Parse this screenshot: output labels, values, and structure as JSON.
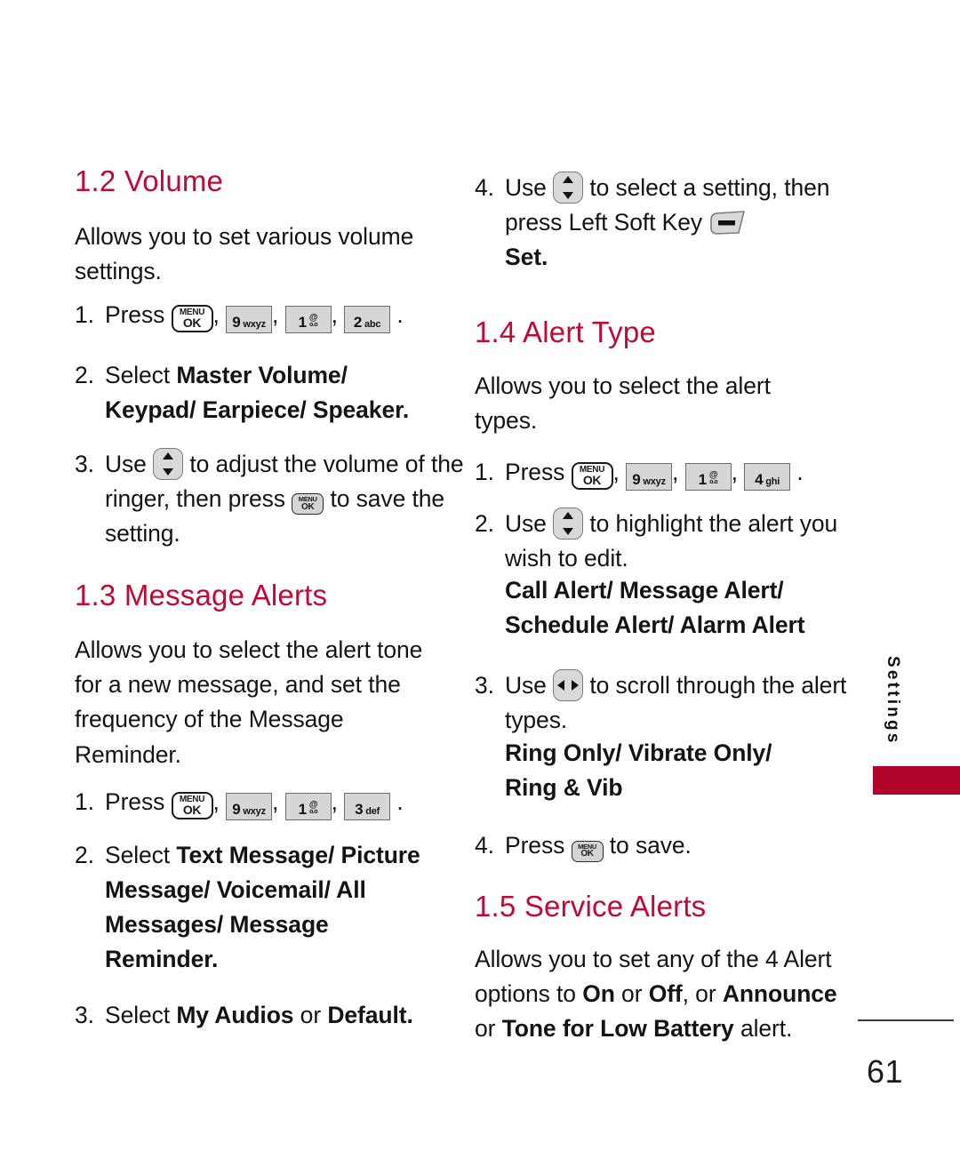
{
  "page": {
    "number": "61",
    "side_tab_label": "Settings",
    "accent_heading_color": "#BE0A34",
    "side_tab_bar_color": "#B2032B"
  },
  "keys": {
    "menu_ok_line1": "MENU",
    "menu_ok_line2": "OK",
    "key9_digit": "9",
    "key9_sub": "wxyz",
    "key1_digit": "1",
    "key1_sub_top": "@",
    "key1_sub_bottom": "o.o",
    "key2_digit": "2",
    "key2_sub": "abc",
    "key3_digit": "3",
    "key3_sub": "def",
    "key4_digit": "4",
    "key4_sub": "ghi",
    "nav_updown_name": "up-down-navigation-key",
    "nav_leftright_name": "left-right-navigation-key",
    "left_soft_key_name": "left-soft-key"
  },
  "left_column": {
    "section_1_2": {
      "heading": "1.2 Volume",
      "intro": "Allows you to set various volume settings.",
      "step1_num": "1.",
      "step1_label": "Press",
      "step1_tail": ".",
      "step2_num": "2.",
      "step2_lead": "Select ",
      "step2_bold_line1": "Master Volume/",
      "step2_bold_line2": "Keypad/ Earpiece/ Speaker",
      "step2_tail": ".",
      "step3_num": "3.",
      "step3_lead": "Use ",
      "step3_mid": " to adjust the volume of the ringer, then press ",
      "step3_tail": " to save the setting."
    },
    "section_1_3": {
      "heading": "1.3 Message Alerts",
      "intro": "Allows you to select the alert tone for a new message, and set the frequency of the Message Reminder.",
      "step1_num": "1.",
      "step1_label": "Press",
      "step1_tail": ".",
      "step2_num": "2.",
      "step2_lead": "Select ",
      "step2_bold_line1": "Text Message/ Picture",
      "step2_bold_line2": "Message/ Voicemail/ All",
      "step2_bold_line3": "Messages/ Message",
      "step2_bold_line4": "Reminder",
      "step2_tail": ".",
      "step3_num": "3.",
      "step3_lead": "Select ",
      "step3_bold_1": "My Audios",
      "step3_mid": " or ",
      "step3_bold_2": "Default",
      "step3_tail": "."
    }
  },
  "right_column": {
    "section_1_2_cont": {
      "step4_num": "4.",
      "step4_lead": "Use ",
      "step4_mid": " to select a setting, then press Left Soft Key ",
      "step4_bold": "Set",
      "step4_tail": "."
    },
    "section_1_4": {
      "heading": "1.4 Alert Type",
      "intro": "Allows you to select the alert types.",
      "step1_num": "1.",
      "step1_label": "Press",
      "step1_tail": ".",
      "step2_num": "2.",
      "step2_lead": "Use ",
      "step2_mid": " to highlight the alert you wish to edit.",
      "step2_bold_line1": "Call Alert/ Message Alert/",
      "step2_bold_line2": "Schedule Alert/ Alarm Alert",
      "step3_num": "3.",
      "step3_lead": "Use ",
      "step3_mid": " to scroll through the alert types.",
      "step3_bold_line1": "Ring Only/ Vibrate Only/",
      "step3_bold_line2": "Ring & Vib",
      "step4_num": "4.",
      "step4_lead": "Press ",
      "step4_tail": " to save."
    },
    "section_1_5": {
      "heading": "1.5 Service Alerts",
      "intro_1": "Allows you to set any of the 4 Alert options to ",
      "intro_bold_1": "On",
      "intro_2": " or ",
      "intro_bold_2": "Off",
      "intro_3": ", or ",
      "intro_bold_3": "Announce",
      "intro_4": " or ",
      "intro_bold_4": "Tone for Low Battery",
      "intro_5": " alert."
    }
  }
}
